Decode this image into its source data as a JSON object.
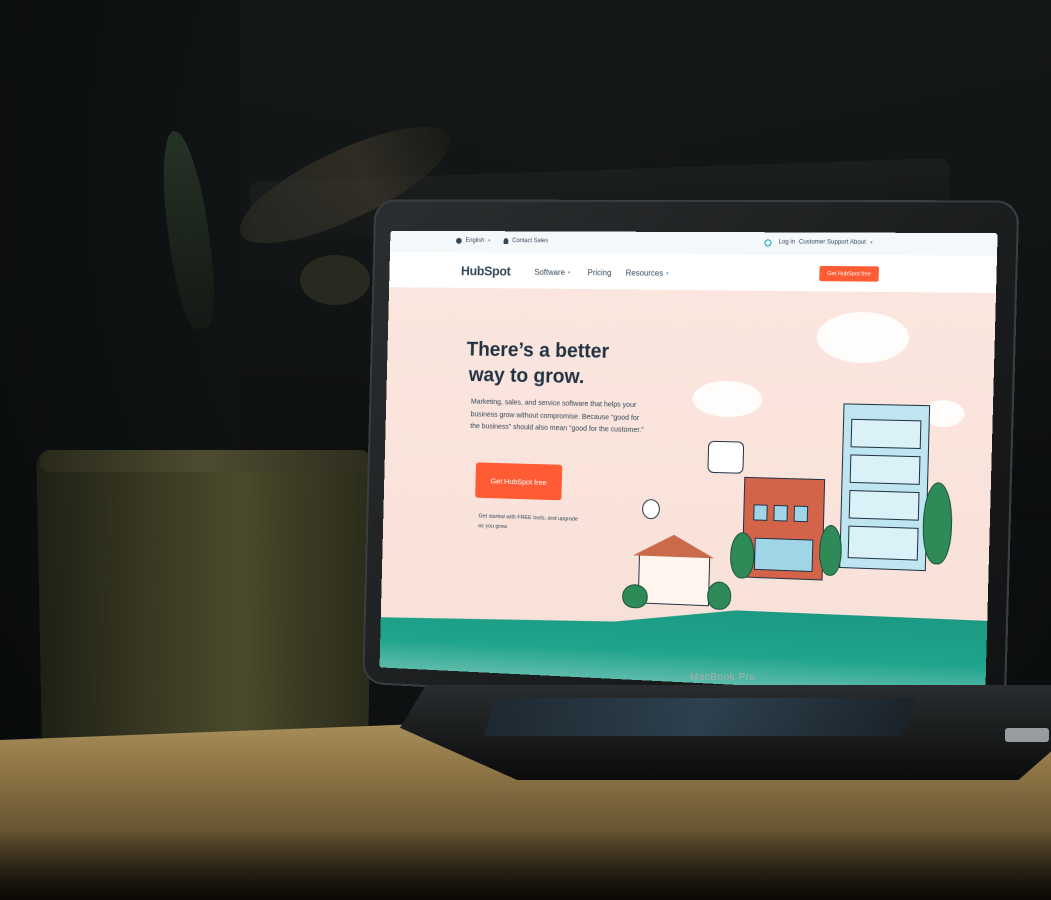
{
  "device": {
    "label": "MacBook Pro"
  },
  "site": {
    "topbar": {
      "language": "English",
      "contact": "Contact Sales",
      "login": "Log in",
      "support": "Customer Support",
      "about": "About"
    },
    "nav": {
      "logo": "HubSpot",
      "links": [
        "Software",
        "Pricing",
        "Resources"
      ],
      "cta": "Get HubSpot free"
    },
    "hero": {
      "title_line1": "There’s a better",
      "title_line2": "way to grow.",
      "body": "Marketing, sales, and service software that helps your business grow without compromise. Because “good for the business” should also mean “good for the customer.”",
      "cta": "Get HubSpot free",
      "note": "Get started with FREE tools, and upgrade as you grow."
    }
  },
  "colors": {
    "accent": "#ff5c35",
    "heading": "#213343",
    "ground": "#20a48b",
    "hero_bg": "#f8e4dc"
  }
}
